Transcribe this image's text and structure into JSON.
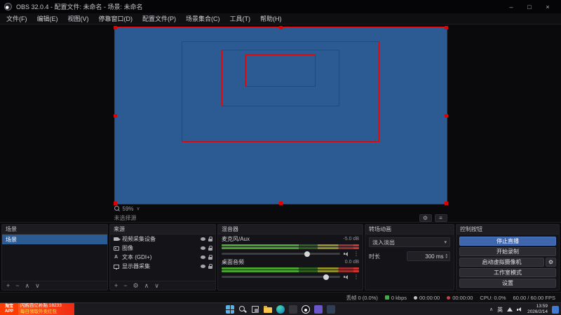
{
  "glyphs": {
    "plus": "+",
    "minus": "−",
    "up_arrow": "∧",
    "down_arrow": "∨",
    "gear": "⚙",
    "dots": "⋮",
    "dropdown": "▾",
    "spin_up": "▴",
    "spin_down": "▾",
    "menu": "≡",
    "text_icon": "A",
    "minimize": "–",
    "maximize": "□",
    "close": "×",
    "chevron_up": "∧",
    "chevron_down": "∨"
  },
  "titlebar": {
    "title": "OBS 32.0.4 - 配置文件: 未命名 - 场景: 未命名"
  },
  "menus": [
    "文件(F)",
    "编辑(E)",
    "视图(V)",
    "停靠窗口(D)",
    "配置文件(P)",
    "场景集合(C)",
    "工具(T)",
    "帮助(H)"
  ],
  "preview": {
    "zoom_level": "59%",
    "no_source_text": "未选择源"
  },
  "docks": {
    "scenes": {
      "title": "场景",
      "items": [
        {
          "name": "场景",
          "selected": true
        }
      ]
    },
    "sources": {
      "title": "来源",
      "items": [
        {
          "name": "视频采集设备",
          "icon": "camera"
        },
        {
          "name": "图像",
          "icon": "image"
        },
        {
          "name": "文本 (GDI+)",
          "icon": "text"
        },
        {
          "name": "显示器采集",
          "icon": "monitor"
        }
      ]
    },
    "mixer": {
      "title": "混音器",
      "channels": [
        {
          "name": "麦克风/Aux",
          "db": "-5.0 dB"
        },
        {
          "name": "桌面音频",
          "db": "0.0 dB"
        }
      ]
    },
    "transitions": {
      "title": "转场动画",
      "selected": "淡入淡出",
      "duration_label": "时长",
      "duration_value": "300 ms"
    },
    "controls": {
      "title": "控制按钮",
      "stream": "停止直播",
      "record": "开始录制",
      "virtual_cam": "启动虚拟摄像机",
      "studio_mode": "工作室模式",
      "settings": "设置"
    }
  },
  "statusbar": {
    "dropped_frames": "丢帧 0 (0.0%)",
    "bitrate": "0 kbps",
    "stream_time": "00:00:00",
    "record_time": "00:00:00",
    "cpu": "CPU: 0.0%",
    "fps": "60.00 / 60.00 FPS"
  },
  "taskbar": {
    "ad": {
      "app_name": "淘宝APP",
      "line1": "闪购百亿补贴 18233",
      "line2": "每日领取外卖红包"
    },
    "tray": {
      "ime": "英",
      "time": "13:59",
      "date": "2026/2/14"
    }
  },
  "colors": {
    "accent_blue": "#3f66ad",
    "selection_blue": "#2c5b94",
    "selection_border_red": "#e00000",
    "meter_green": "#4aa32e",
    "ad_red": "#ff3c00"
  }
}
